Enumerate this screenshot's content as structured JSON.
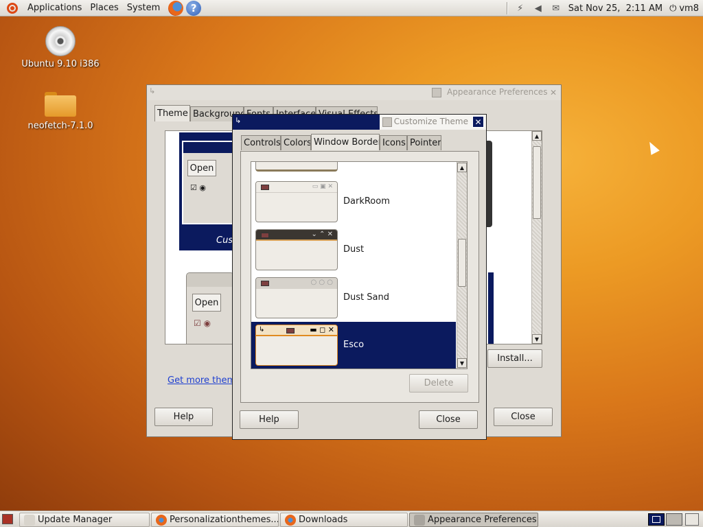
{
  "top_panel": {
    "menus": [
      "Applications",
      "Places",
      "System"
    ],
    "clock": "Sat Nov 25,  2:11 AM",
    "user": "vm8"
  },
  "desktop": {
    "icons": [
      {
        "label": "Ubuntu 9.10 i386",
        "icon": "cd-icon"
      },
      {
        "label": "neofetch-7.1.0",
        "icon": "folder-icon"
      }
    ]
  },
  "appearance": {
    "title": "Appearance Preferences",
    "tabs": [
      "Theme",
      "Background",
      "Fonts",
      "Interface",
      "Visual Effects"
    ],
    "preview_open": "Open",
    "preview_custom": "Cus",
    "more_link": "Get more them",
    "install": "Install...",
    "help": "Help",
    "close": "Close"
  },
  "customize": {
    "title": "Customize Theme",
    "tabs": [
      "Controls",
      "Colors",
      "Window Border",
      "Icons",
      "Pointer"
    ],
    "active_tab": "Window Border",
    "items": [
      {
        "name": "DarkRoom"
      },
      {
        "name": "Dust"
      },
      {
        "name": "Dust Sand"
      },
      {
        "name": "Esco",
        "selected": true
      }
    ],
    "delete": "Delete",
    "help": "Help",
    "close": "Close"
  },
  "taskbar": {
    "tasks": [
      "Update Manager",
      "Personalizationthemes...",
      "Downloads",
      "Appearance Preferences"
    ],
    "active_task": "Appearance Preferences"
  },
  "colors": {
    "selection": "#0b1a5e",
    "wallpaper": "#e08a20",
    "panel": "#dedad3"
  }
}
